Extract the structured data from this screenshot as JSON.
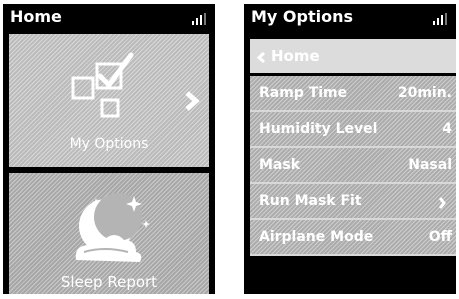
{
  "home_screen": {
    "title": "Home",
    "tiles": [
      {
        "label": "My Options",
        "icon": "checklist-icon"
      },
      {
        "label": "Sleep Report",
        "icon": "moon-cloud-icon"
      }
    ]
  },
  "options_screen": {
    "title": "My Options",
    "back_label": "Home",
    "settings": [
      {
        "label": "Ramp Time",
        "value": "20min."
      },
      {
        "label": "Humidity Level",
        "value": "4"
      },
      {
        "label": "Mask",
        "value": "Nasal"
      },
      {
        "label": "Run Mask Fit",
        "value": ""
      },
      {
        "label": "Airplane Mode",
        "value": "Off"
      }
    ]
  },
  "colors": {
    "screen_background": "#000000",
    "tile_gray": "#c9c9c9",
    "row_gray": "#b9b9b9",
    "highlight_row": "#dcdcdc",
    "text": "#ffffff"
  },
  "icons": [
    "signal-icon",
    "checklist-icon",
    "chevron-right-icon",
    "moon-cloud-icon",
    "chevron-left-icon"
  ]
}
